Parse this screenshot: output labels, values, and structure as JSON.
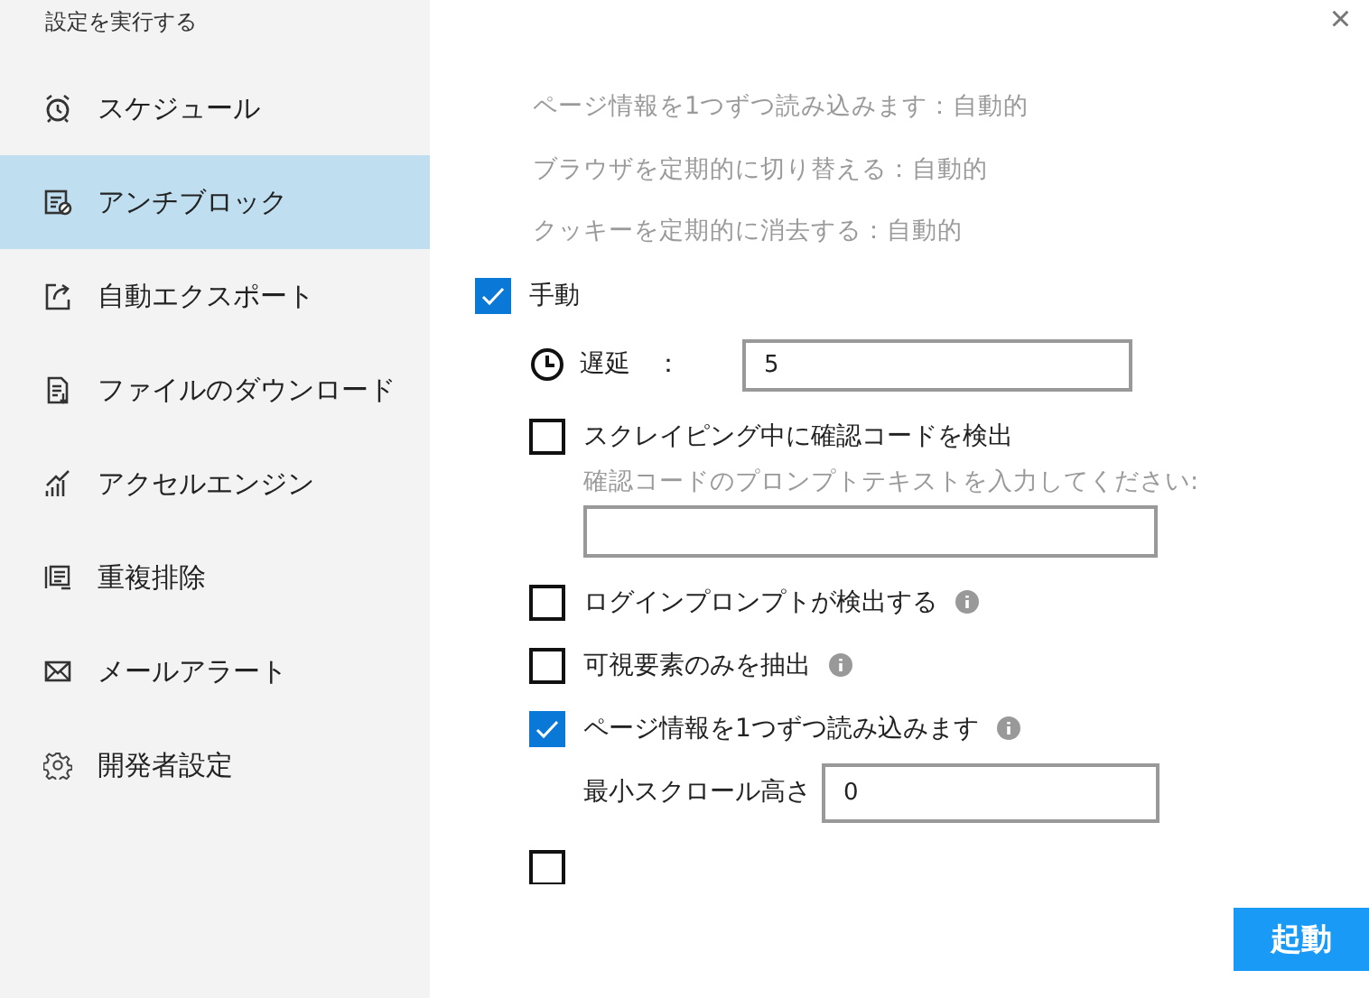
{
  "sidebar": {
    "title": "設定を実行する",
    "items": [
      {
        "label": "スケジュール",
        "selected": false
      },
      {
        "label": "アンチブロック",
        "selected": true
      },
      {
        "label": "自動エクスポート",
        "selected": false
      },
      {
        "label": "ファイルのダウンロード",
        "selected": false
      },
      {
        "label": "アクセルエンジン",
        "selected": false
      },
      {
        "label": "重複排除",
        "selected": false
      },
      {
        "label": "メールアラート",
        "selected": false
      },
      {
        "label": "開発者設定",
        "selected": false
      }
    ]
  },
  "close": "×",
  "auto_notes": [
    "ページ情報を1つずつ読み込みます：自動的",
    "ブラウザを定期的に切り替える：自動的",
    "クッキーを定期的に消去する：自動的"
  ],
  "manual": {
    "label": "手動",
    "checked": true
  },
  "options": [
    {
      "kind": "delay",
      "label": "遅延　：",
      "value": "5"
    },
    {
      "kind": "checkbox",
      "label": "スクレイピング中に確認コードを検出",
      "checked": false,
      "hint": "確認コードのプロンプトテキストを入力してください:"
    },
    {
      "kind": "checkbox",
      "label": "ログインプロンプトが検出する",
      "checked": false,
      "info": true
    },
    {
      "kind": "checkbox",
      "label": "可視要素のみを抽出",
      "checked": false,
      "info": true
    },
    {
      "kind": "checkbox",
      "label": "ページ情報を1つずつ読み込みます",
      "checked": true,
      "info": true,
      "field_label": "最小スクロール高さ",
      "value": "0"
    },
    {
      "kind": "checkbox",
      "checked": false
    }
  ],
  "start_button": "起動"
}
